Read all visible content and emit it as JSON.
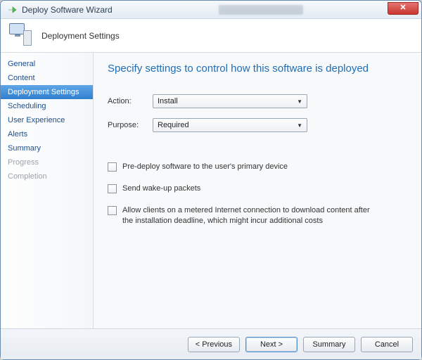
{
  "window": {
    "title": "Deploy Software Wizard"
  },
  "header": {
    "title": "Deployment Settings"
  },
  "sidebar": {
    "items": [
      {
        "label": "General",
        "state": "normal"
      },
      {
        "label": "Content",
        "state": "normal"
      },
      {
        "label": "Deployment Settings",
        "state": "active"
      },
      {
        "label": "Scheduling",
        "state": "normal"
      },
      {
        "label": "User Experience",
        "state": "normal"
      },
      {
        "label": "Alerts",
        "state": "normal"
      },
      {
        "label": "Summary",
        "state": "normal"
      },
      {
        "label": "Progress",
        "state": "disabled"
      },
      {
        "label": "Completion",
        "state": "disabled"
      }
    ]
  },
  "main": {
    "heading": "Specify settings to control how this software is deployed",
    "fields": {
      "action": {
        "label": "Action:",
        "value": "Install"
      },
      "purpose": {
        "label": "Purpose:",
        "value": "Required"
      }
    },
    "checkboxes": {
      "predeploy": {
        "label": "Pre-deploy software to the user's primary device",
        "checked": false
      },
      "wakeup": {
        "label": "Send wake-up packets",
        "checked": false
      },
      "metered": {
        "label": "Allow clients on a metered Internet connection to download content after the installation deadline, which might incur additional costs",
        "checked": false
      }
    }
  },
  "footer": {
    "previous": "< Previous",
    "next": "Next >",
    "summary": "Summary",
    "cancel": "Cancel"
  }
}
